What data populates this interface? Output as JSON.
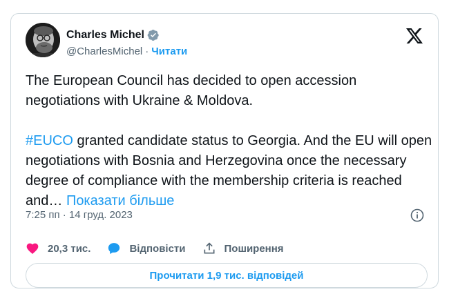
{
  "tweet": {
    "author": {
      "name": "Charles Michel",
      "handle": "@CharlesMichel",
      "separator": "·",
      "follow_label": "Читати",
      "verified_color": "#829aab"
    },
    "text": {
      "line1": "The European Council has decided to open accession negotiations with Ukraine & Moldova.",
      "hashtag": "#EUCO",
      "line2": " granted candidate status to Georgia. And the EU will open negotiations with Bosnia and Herzegovina once the necessary degree of compliance with the membership criteria  is reached and… ",
      "show_more": "Показати більше"
    },
    "timestamp": "7:25 пп · 14 груд. 2023",
    "actions": {
      "likes": "20,3 тис.",
      "reply_label": "Відповісти",
      "share_label": "Поширення"
    },
    "read_replies_label": "Прочитати 1,9 тис. відповідей",
    "colors": {
      "accent": "#1d9bf0",
      "like": "#f91880",
      "secondary_text": "#536471",
      "border": "#cfd9de"
    },
    "icons": [
      "verified-badge-icon",
      "x-logo-icon",
      "info-icon",
      "heart-icon",
      "reply-bubble-icon",
      "share-icon"
    ]
  }
}
